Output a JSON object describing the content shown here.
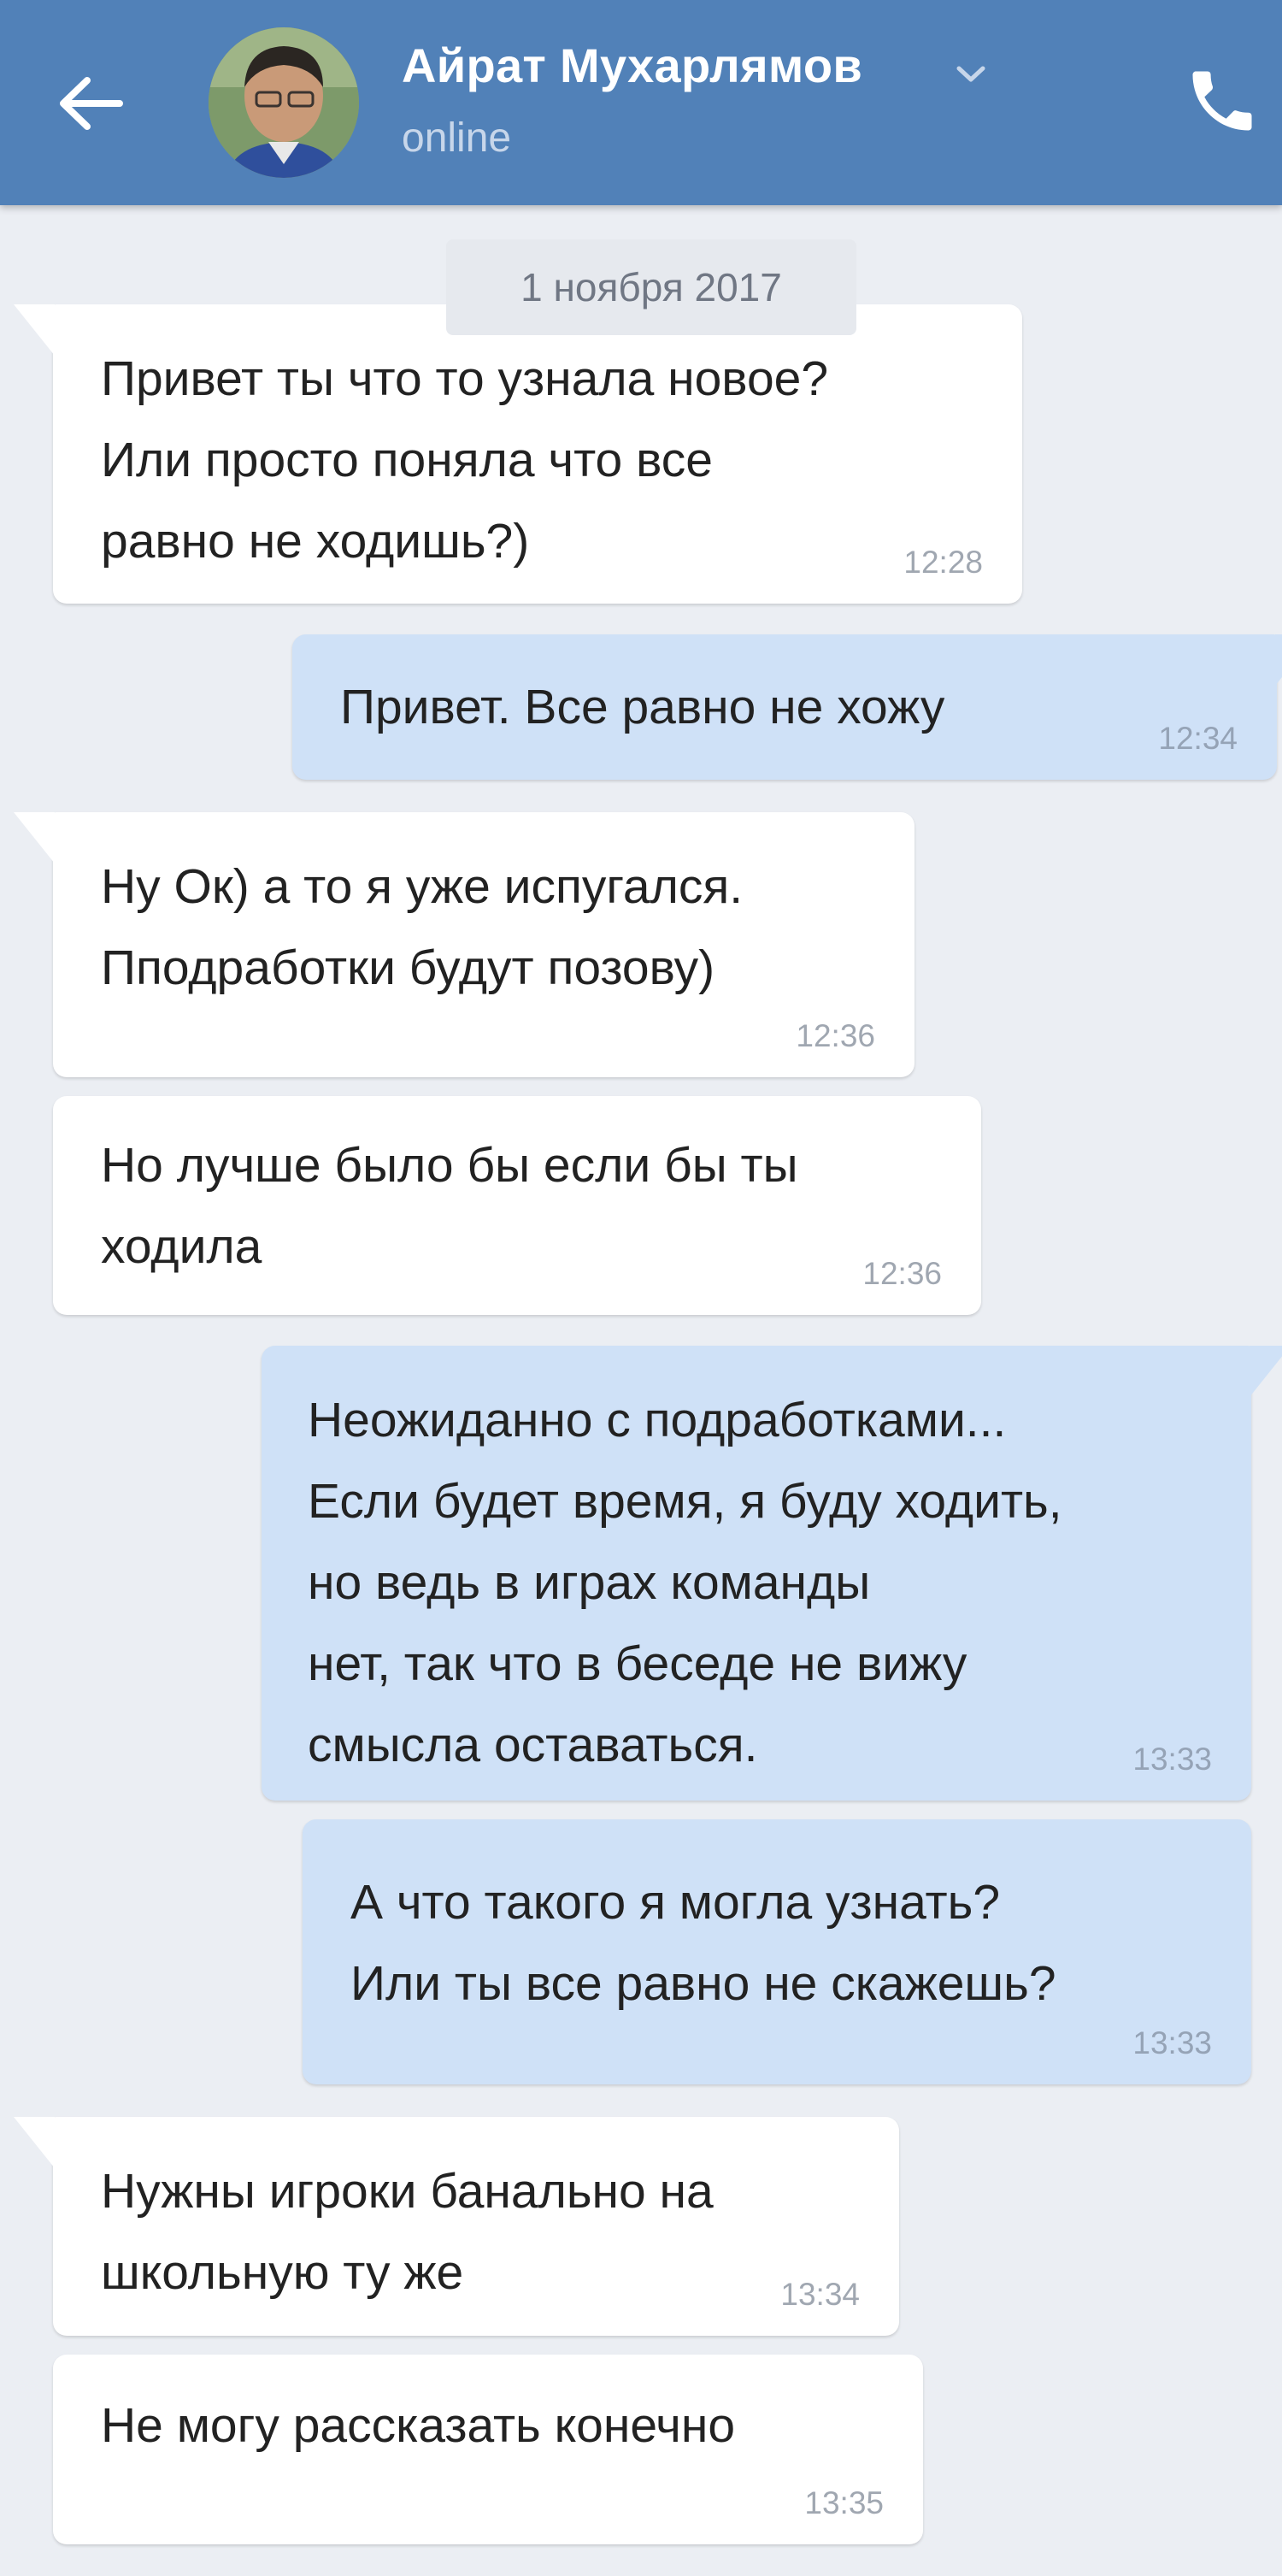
{
  "header": {
    "contact_name": "Айрат Мухарлямов",
    "status": "online",
    "icons": [
      "back-arrow-icon",
      "avatar",
      "chevron-down-icon",
      "phone-icon"
    ]
  },
  "date_label": "1 ноября 2017",
  "colors": {
    "header_bg": "#5181b8",
    "chat_bg": "#ebeef3",
    "incoming_bubble": "#ffffff",
    "outgoing_bubble": "#cfe1f7"
  },
  "messages": [
    {
      "direction": "incoming",
      "text": "Привет ты что то узнала новое?\nИли просто поняла что все\nравно не ходишь?)",
      "time": "12:28"
    },
    {
      "direction": "outgoing",
      "text": "Привет. Все равно не хожу",
      "time": "12:34"
    },
    {
      "direction": "incoming",
      "text": "Ну Ок) а то я уже испугался.\nПподработки будут позову)",
      "time": "12:36"
    },
    {
      "direction": "incoming",
      "text": "Но лучше было бы если бы ты\nходила",
      "time": "12:36"
    },
    {
      "direction": "outgoing",
      "text": "Неожиданно с подработками...\nЕсли будет время, я буду ходить,\nно ведь в играх команды\nнет, так что в беседе не вижу\nсмысла оставаться.",
      "time": "13:33"
    },
    {
      "direction": "outgoing",
      "text": "А что такого я могла узнать?\nИли ты все равно не скажешь?",
      "time": "13:33"
    },
    {
      "direction": "incoming",
      "text": "Нужны игроки банально на\nшкольную ту же",
      "time": "13:34"
    },
    {
      "direction": "incoming",
      "text": "Не могу рассказать конечно",
      "time": "13:35"
    }
  ]
}
